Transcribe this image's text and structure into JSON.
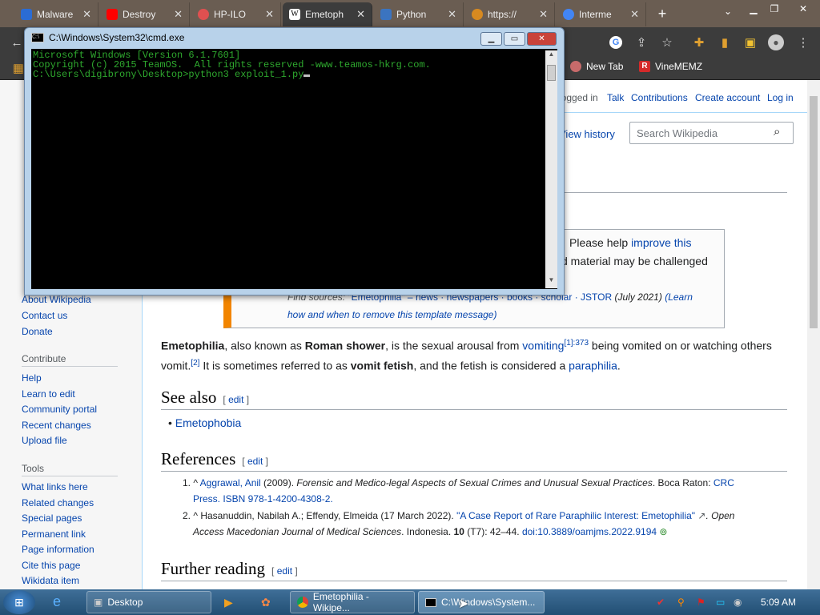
{
  "browser": {
    "tabs": [
      {
        "label": "Malware",
        "color": "#2b6cd4"
      },
      {
        "label": "Destroy",
        "color": "#ff0000"
      },
      {
        "label": "HP-ILO",
        "color": "#e05050"
      },
      {
        "label": "Emetoph",
        "color": "#ffffff"
      },
      {
        "label": "Python",
        "color": "#3b74c0"
      },
      {
        "label": "https://",
        "color": "#d88a20"
      },
      {
        "label": "Interme",
        "color": "#4285f4"
      }
    ],
    "bookmarks": [
      "New Tab",
      "VineMEMZ"
    ]
  },
  "wiki": {
    "user_links": [
      "logged in",
      "Talk",
      "Contributions",
      "Create account",
      "Log in"
    ],
    "view_history": "View history",
    "search_placeholder": "Search Wikipedia",
    "sidebar": {
      "nav_links": [
        "About Wikipedia",
        "Contact us",
        "Donate"
      ],
      "contribute_head": "Contribute",
      "contribute_links": [
        "Help",
        "Learn to edit",
        "Community portal",
        "Recent changes",
        "Upload file"
      ],
      "tools_head": "Tools",
      "tools_links": [
        "What links here",
        "Related changes",
        "Special pages",
        "Permanent link",
        "Page information",
        "Cite this page",
        "Wikidata item"
      ]
    },
    "ambox": {
      "line1_pre": "Please help ",
      "line1_link": "improve this",
      "line2": "d material may be challenged",
      "line3_pre": "Find sources: ",
      "line3_links": "\"Emetophilia\" – news · newspapers · books · scholar · JSTOR",
      "line3_date": "(July 2021)",
      "line3_learn": "(Learn",
      "line4": "how and when to remove this template message)"
    },
    "intro": {
      "term": "Emetophilia",
      "t1": ", also known as ",
      "alias": "Roman shower",
      "t2": ", is the sexual arousal from ",
      "link1": "vomiting",
      "sup1": "[1]:373",
      "t3": " being vomited on or watching others",
      "t4": "vomit.",
      "sup2": "[2]",
      "t5": " It is sometimes referred to as ",
      "alias2": "vomit fetish",
      "t6": ", and the fetish is considered a ",
      "link2": "paraphilia",
      "t7": "."
    },
    "see_also": {
      "heading": "See also",
      "edit": "edit",
      "items": [
        "Emetophobia"
      ]
    },
    "references": {
      "heading": "References",
      "edit": "edit",
      "r1_a": "1. ^ ",
      "r1_author": "Aggrawal, Anil",
      "r1_year": " (2009). ",
      "r1_title": "Forensic and Medico-legal Aspects of Sexual Crimes and Unusual Sexual Practices",
      "r1_pub": ". Boca Raton: ",
      "r1_press": "CRC",
      "r1_l2": "Press. ISBN 978-1-4200-4308-2.",
      "r2_a": "2. ^ ",
      "r2_authors": "Hasanuddin, Nabilah A.; Effendy, Elmeida (17 March 2022). ",
      "r2_title": "\"A Case Report of Rare Paraphilic Interest: Emetophilia\"",
      "r2_journal": ". Open",
      "r2_l2a": "Access Macedonian Journal of Medical Sciences",
      "r2_l2b": ". Indonesia. ",
      "r2_vol": "10",
      "r2_l2c": " (T7): 42–44. ",
      "r2_doi": "doi:10.3889/oamjms.2022.9194"
    },
    "further": {
      "heading": "Further reading",
      "edit": "edit"
    }
  },
  "cmd": {
    "title": "C:\\Windows\\System32\\cmd.exe",
    "lines": [
      "Microsoft Windows [Version 6.1.7601]",
      "Copyright (c) 2015 TeamOS.  All rights reserved -www.teamos-hkrg.com.",
      "",
      "C:\\Users\\digibrony\\Desktop>python3 exploit_1.py"
    ]
  },
  "taskbar": {
    "tasks": [
      "Desktop",
      "Emetophilia - Wikipe...",
      "C:\\Windows\\System..."
    ],
    "clock": "5:09 AM"
  }
}
